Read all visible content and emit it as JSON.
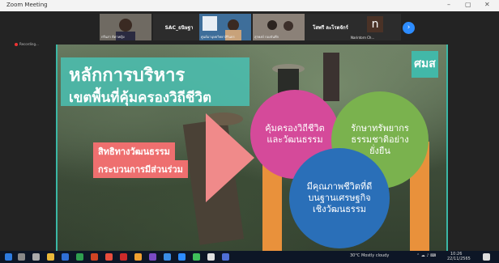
{
  "window": {
    "title": "Zoom Meeting",
    "minimize": "–",
    "maximize": "▢",
    "close": "✕"
  },
  "recording": {
    "label": "Recording..."
  },
  "participants": [
    {
      "name": "กรีนสา ธิดาหญิง",
      "caption": ""
    },
    {
      "name": "SAC_ธนิษฐา",
      "caption": ""
    },
    {
      "name": "Sirindhorn",
      "caption": "ศูนย์มานุษยวิทยาสิรินธร"
    },
    {
      "name": "สุรพงษ์ กองจันทึก",
      "caption": ""
    },
    {
      "name": "โสพรี ละโรตจักร์",
      "caption": ""
    },
    {
      "name": "n",
      "caption": "Narintorn Ch..."
    }
  ],
  "next_icon": "›",
  "slide": {
    "title_line1": "หลักการบริหาร",
    "title_line2": "เขตพื้นที่คุ้มครองวิถีชีวิต",
    "logo_text": "ศมส",
    "label_rights": "สิทธิทางวัฒนธรรม",
    "label_process": "กระบวนการมีส่วนร่วม",
    "circle_pink": "คุ้มครองวิถีชีวิต และวัฒนธรรม",
    "circle_green": "รักษาทรัพยากร ธรรมชาติอย่าง ยั่งยืน",
    "circle_blue": "มีคุณภาพชีวิตที่ดี บนฐานเศรษฐกิจ เชิงวัฒนธรรม"
  },
  "colors": {
    "teal": "#46bca9",
    "pink": "#d54a9a",
    "green": "#7ab24e",
    "blue": "#2a6fb8",
    "coral": "#ef6a6a",
    "orange": "#e9913b"
  },
  "taskbar": {
    "weather": "30°C Mostly cloudy",
    "time": "10:26",
    "date": "22/11/2565"
  }
}
